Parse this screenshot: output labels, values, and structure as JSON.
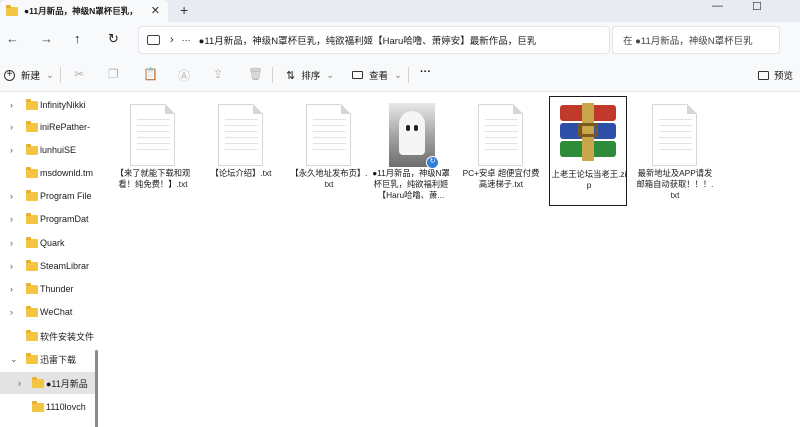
{
  "window": {
    "tab_title": "●11月新品，神级N罩杯巨乳，",
    "tab_close": "✕",
    "tab_add": "+",
    "minimize": "—",
    "maximize": "☐"
  },
  "nav": {
    "back": "←",
    "forward": "→",
    "up": "↑",
    "refresh": "↻",
    "chevron": "›",
    "more": "···",
    "address": "●11月新品，神级N罩杯巨乳，纯欲福利姬【Haru哈噜、萧婷安】最新作品，巨乳",
    "search_placeholder": "在 ●11月新品，神级N罩杯巨乳"
  },
  "toolbar": {
    "new_label": "新建",
    "new_chevron": "⌄",
    "sort_label": "排序",
    "sort_chevron": "⌄",
    "view_label": "查看",
    "view_chevron": "⌄",
    "more": "···",
    "preview_label": "预览",
    "icons": [
      "cut-icon",
      "copy-icon",
      "paste-icon",
      "rename-icon",
      "share-icon",
      "delete-icon"
    ]
  },
  "sidebar": {
    "items": [
      {
        "label": "InfinityNikki",
        "chevron": "›",
        "expanded": false
      },
      {
        "label": "iniRePather-",
        "chevron": "›",
        "expanded": false
      },
      {
        "label": "lunhuiSE",
        "chevron": "›",
        "expanded": false
      },
      {
        "label": "msdownld.tm",
        "chevron": "",
        "expanded": false
      },
      {
        "label": "Program File",
        "chevron": "›",
        "expanded": false
      },
      {
        "label": "ProgramDat",
        "chevron": "›",
        "expanded": false
      },
      {
        "label": "Quark",
        "chevron": "›",
        "expanded": false
      },
      {
        "label": "SteamLibrar",
        "chevron": "›",
        "expanded": false
      },
      {
        "label": "Thunder",
        "chevron": "›",
        "expanded": false
      },
      {
        "label": "WeChat",
        "chevron": "›",
        "expanded": false
      },
      {
        "label": "软件安装文件",
        "chevron": "",
        "expanded": false
      },
      {
        "label": "迅雷下载",
        "chevron": "⌄",
        "expanded": true
      },
      {
        "label": "●11月新品",
        "chevron": "›",
        "expanded": false,
        "selected": true
      },
      {
        "label": "1110lovch",
        "chevron": "",
        "expanded": false
      }
    ]
  },
  "files": [
    {
      "name": "【来了就能下载和观看！纯免费！】.txt",
      "type": "txt"
    },
    {
      "name": "【论坛介绍】.txt",
      "type": "txt"
    },
    {
      "name": "【永久地址发布页】.txt",
      "type": "txt"
    },
    {
      "name": "●11月新品，神级N罩杯巨乳，纯欲福利姬【Haru哈噜、萧...",
      "type": "folder-thumb"
    },
    {
      "name": "PC+安卓 超便宜付费高速梯子.txt",
      "type": "txt"
    },
    {
      "name": "上老王论坛当老王.zip",
      "type": "zip",
      "selected": true
    },
    {
      "name": "最新地址及APP请发邮箱自动获取！！！.txt",
      "type": "txt"
    }
  ],
  "colors": {
    "folder": "#f4c542",
    "accent": "#2f7fd8",
    "rar_red": "#c0392b",
    "rar_blue": "#2e4fa8",
    "rar_green": "#2e8b3a"
  }
}
